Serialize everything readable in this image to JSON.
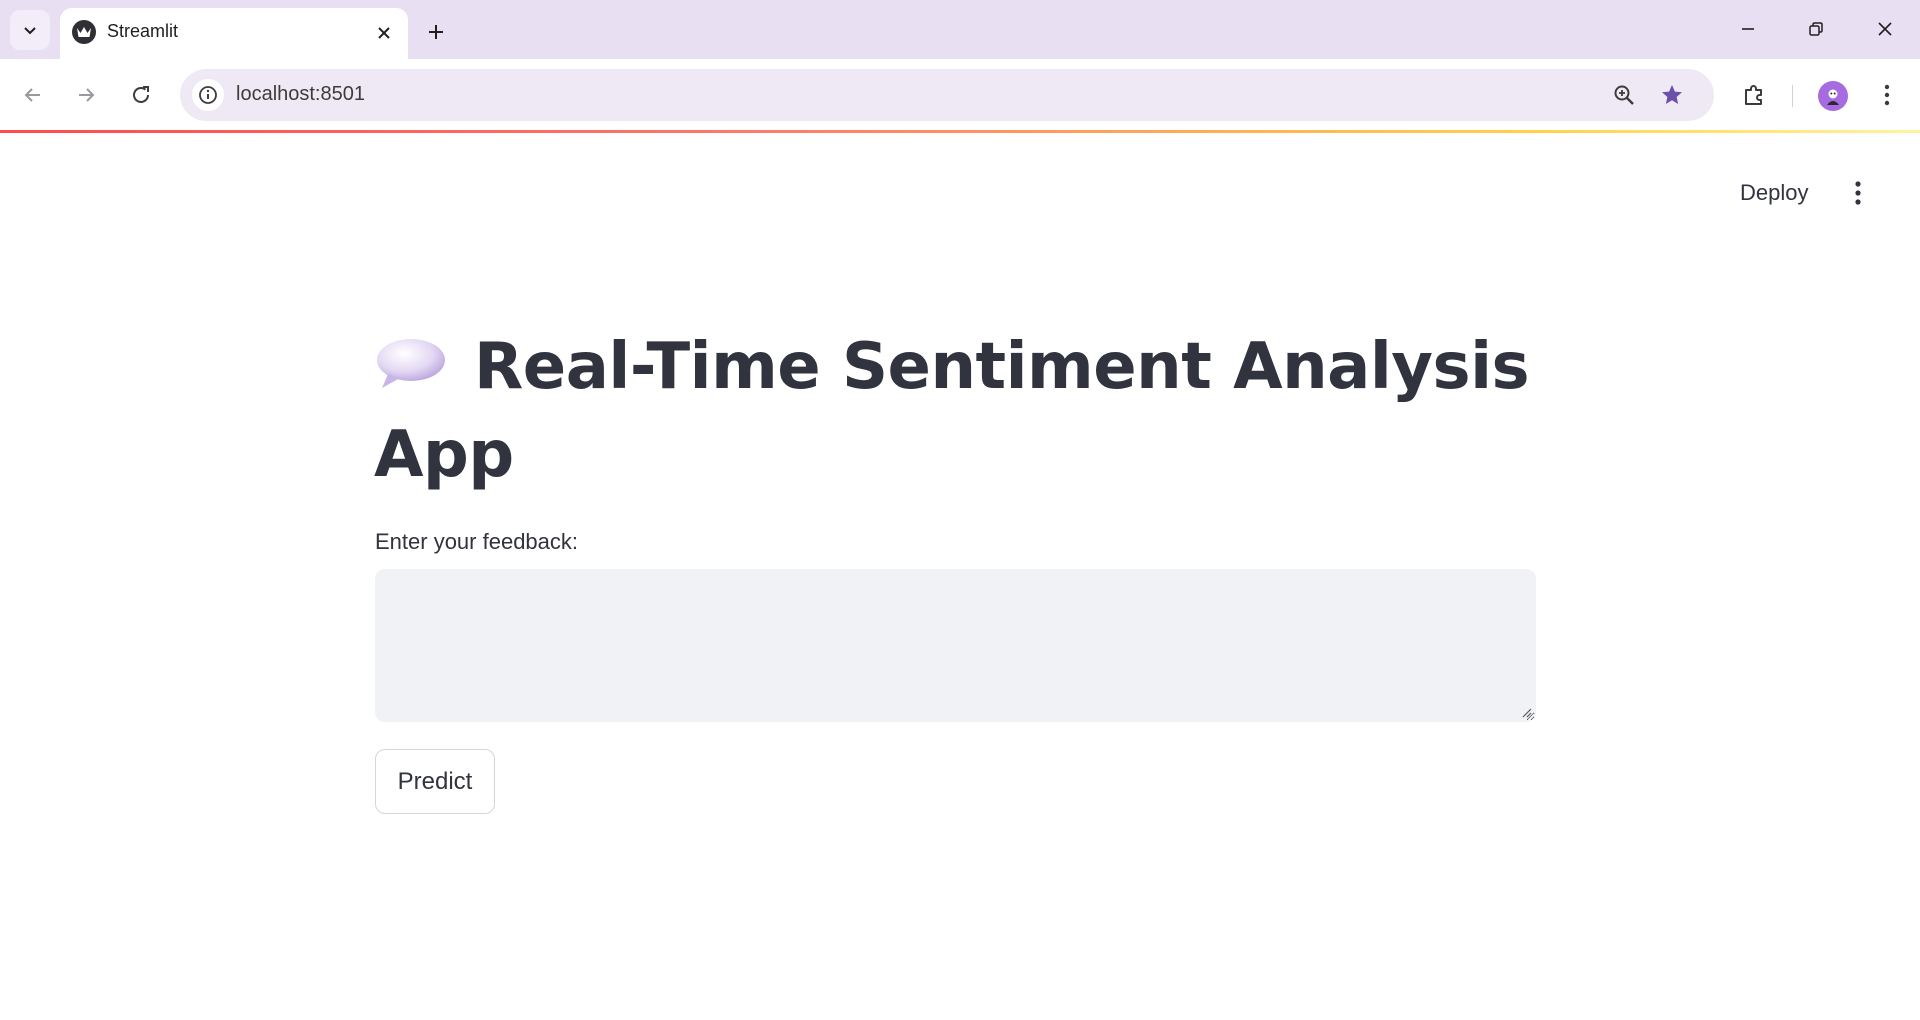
{
  "browser": {
    "tab": {
      "title": "Streamlit"
    },
    "address_bar": {
      "url": "localhost:8501"
    },
    "colors": {
      "chrome": "#e9dff3",
      "accent_star": "#6b4fa8",
      "loading_bar": "#ff4b4b"
    }
  },
  "app": {
    "header": {
      "deploy_label": "Deploy"
    },
    "title": {
      "emoji_icon": "speech-balloon-icon",
      "text": "Real-Time Sentiment Analysis App"
    },
    "feedback": {
      "label": "Enter your feedback:",
      "value": ""
    },
    "predict_button": {
      "label": "Predict"
    },
    "colors": {
      "text": "#31333f",
      "input_bg": "#f0f2f6"
    }
  }
}
